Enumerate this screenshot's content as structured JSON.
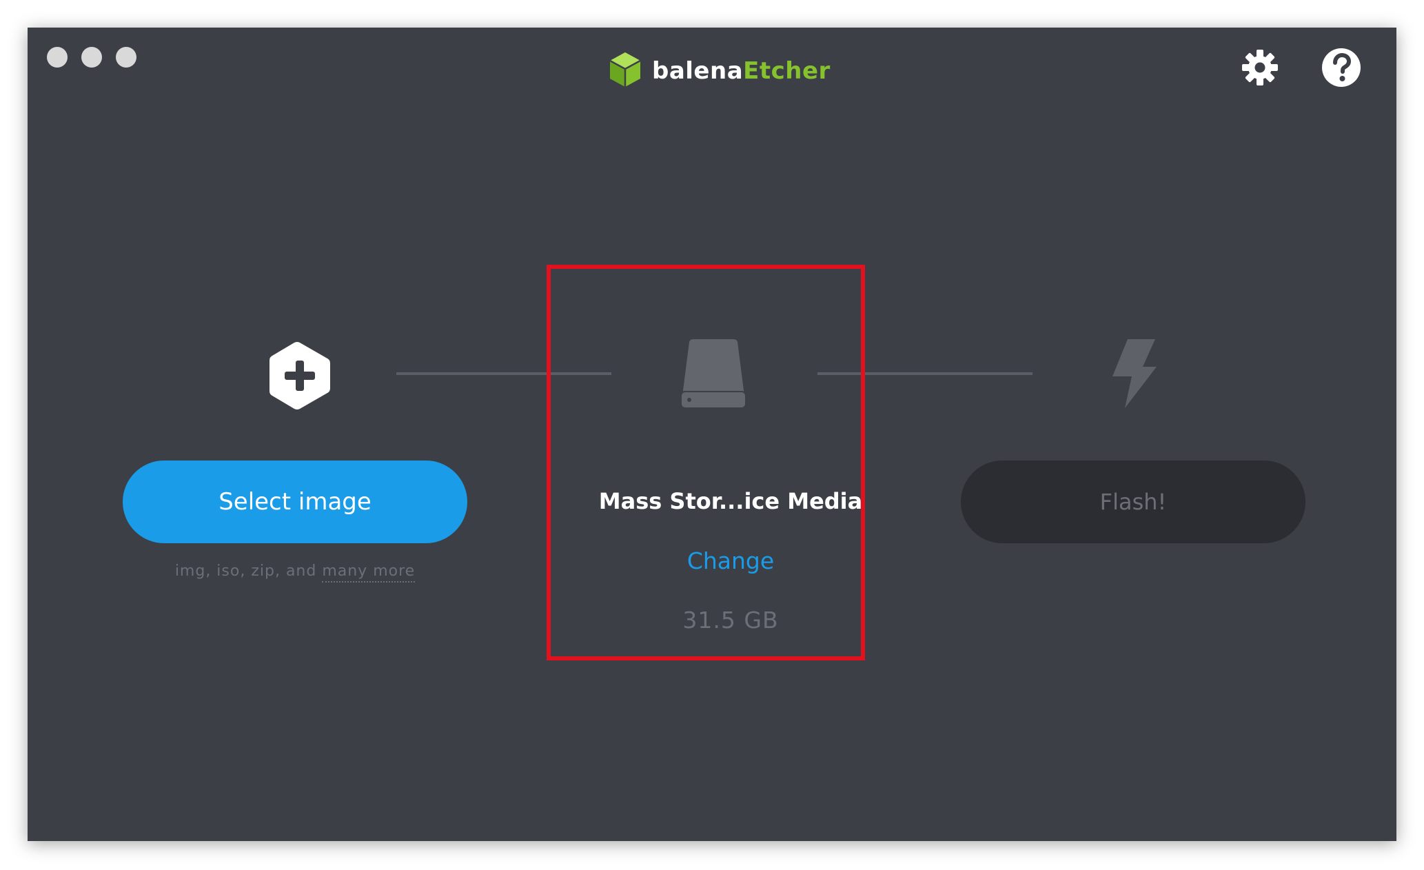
{
  "window": {
    "traffic_lights": [
      "close",
      "minimize",
      "maximize"
    ]
  },
  "brand": {
    "name_part1": "balena",
    "name_part2": "Etcher",
    "logo_icon": "cube-icon",
    "accent_color": "#85c22e"
  },
  "toolbar": {
    "settings_icon": "gear-icon",
    "help_icon": "help-icon"
  },
  "steps": {
    "image": {
      "icon": "plus-hexagon-icon",
      "button_label": "Select image",
      "hint_prefix": "img, iso, zip, and ",
      "hint_link": "many more"
    },
    "drive": {
      "icon": "drive-icon",
      "name": "Mass Stor...ice Media",
      "change_label": "Change",
      "size": "31.5 GB"
    },
    "flash": {
      "icon": "lightning-icon",
      "button_label": "Flash!"
    }
  },
  "colors": {
    "background": "#3c3f46",
    "primary": "#1a9ce8",
    "disabled_button": "#2b2d32",
    "highlight": "#e3101d"
  }
}
